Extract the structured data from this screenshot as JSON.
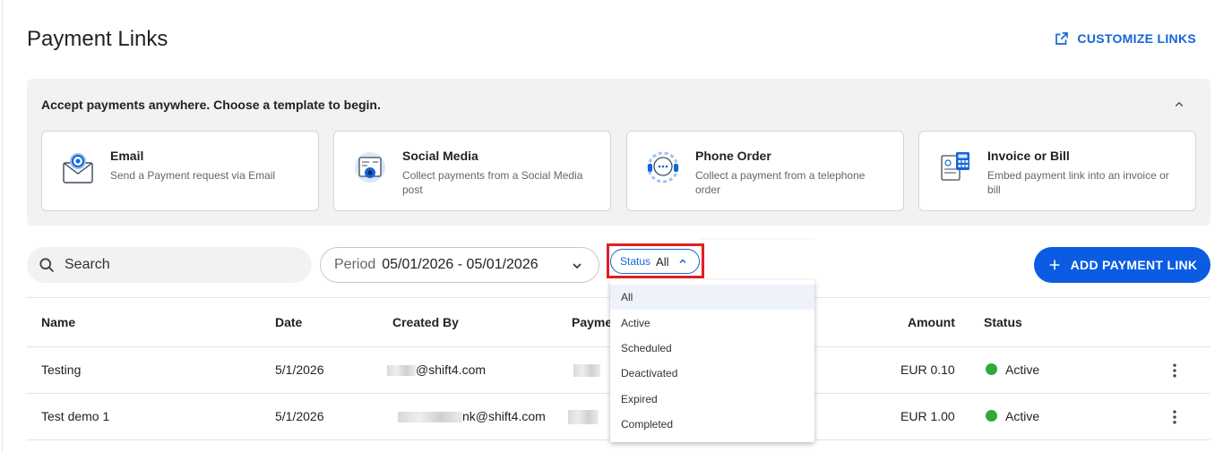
{
  "page": {
    "title": "Payment Links",
    "customize_label": "CUSTOMIZE LINKS"
  },
  "templates": {
    "heading": "Accept payments anywhere. Choose a template to begin.",
    "cards": [
      {
        "title": "Email",
        "desc": "Send a Payment request via Email",
        "icon": "email-template-icon"
      },
      {
        "title": "Social Media",
        "desc": "Collect payments from a Social Media post",
        "icon": "social-media-template-icon"
      },
      {
        "title": "Phone Order",
        "desc": "Collect a payment from a telephone order",
        "icon": "phone-order-template-icon"
      },
      {
        "title": "Invoice or Bill",
        "desc": "Embed payment link into an invoice or bill",
        "icon": "invoice-template-icon"
      }
    ]
  },
  "filters": {
    "search_placeholder": "Search",
    "period_label": "Period",
    "period_value": "05/01/2026 - 05/01/2026",
    "status_label": "Status",
    "status_value": "All",
    "status_options": [
      "All",
      "Active",
      "Scheduled",
      "Deactivated",
      "Expired",
      "Completed"
    ]
  },
  "add_button": "ADD PAYMENT LINK",
  "table": {
    "columns": [
      "Name",
      "Date",
      "Created By",
      "Payme",
      "Amount",
      "Status"
    ],
    "rows": [
      {
        "name": "Testing",
        "date": "5/1/2026",
        "created_by": "@shift4.com",
        "amount": "EUR 0.10",
        "status": "Active"
      },
      {
        "name": "Test demo 1",
        "date": "5/1/2026",
        "created_by": "nk@shift4.com",
        "amount": "EUR 1.00",
        "status": "Active"
      }
    ]
  },
  "colors": {
    "accent": "#1565d8",
    "primary_button": "#0b5ce3",
    "active_status": "#2eaa3c",
    "highlight": "#e02020"
  }
}
